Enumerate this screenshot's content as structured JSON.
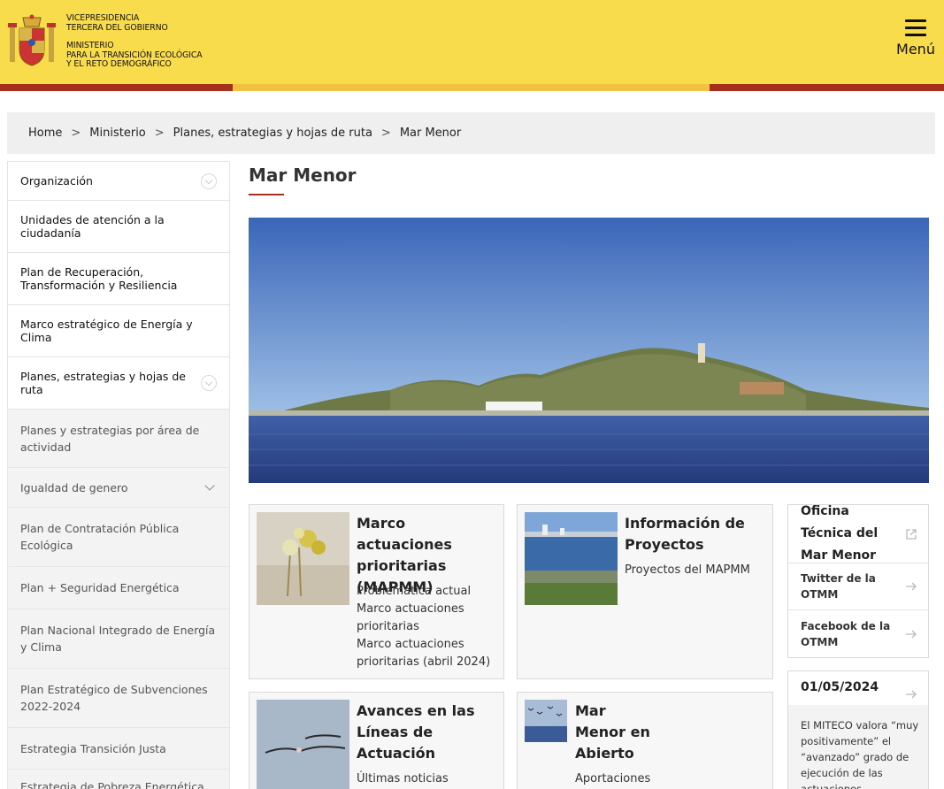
{
  "header": {
    "ministry_line1": "Vicepresidencia",
    "ministry_line2": "Tercera del Gobierno",
    "ministry_line3": "Ministerio",
    "ministry_line4": "para la Transición Ecológica",
    "ministry_line5": "y el Reto Demográfico",
    "menu_label": "Menú",
    "colors": {
      "yellow": "#f8dc4c",
      "red": "#a5301e"
    }
  },
  "breadcrumb": {
    "items": [
      "Home",
      "Ministerio",
      "Planes, estrategias y hojas de ruta",
      "Mar Menor"
    ],
    "separator": ">"
  },
  "sidebar": {
    "items": [
      {
        "label": "Organización"
      },
      {
        "label": "Unidades de atención a la ciudadanía"
      },
      {
        "label": "Plan de Recuperación, Transformación y Resiliencia"
      },
      {
        "label": "Marco estratégico de Energía y Clima"
      },
      {
        "label": "Planes, estrategias y hojas de ruta"
      }
    ],
    "subitems": [
      {
        "label": "Planes y estrategias por área de actividad"
      },
      {
        "label": "Igualdad de genero"
      },
      {
        "label": "Plan de Contratación Pública Ecológica"
      },
      {
        "label": "Plan + Seguridad Energética"
      },
      {
        "label": "Plan Nacional Integrado de Energía y Clima"
      },
      {
        "label": "Plan Estratégico de Subvenciones 2022-2024"
      },
      {
        "label": "Estrategia Transición Justa"
      },
      {
        "label": "Estrategia de Pobreza Energética"
      }
    ]
  },
  "main": {
    "title": "Mar Menor",
    "cards": [
      {
        "title": "Marco actuaciones prioritarias (MAPMM)",
        "links": [
          "Problemática actual",
          "Marco actuaciones prioritarias",
          "Marco actuaciones prioritarias (abril 2024)"
        ]
      },
      {
        "title": "Información de Proyectos",
        "links": [
          "Proyectos del MAPMM"
        ]
      },
      {
        "title": "Avances en las Líneas de Actuación",
        "links": [
          "Últimas noticias"
        ]
      },
      {
        "title": "Mar Menor en Abierto",
        "links": [
          "Aportaciones"
        ]
      }
    ]
  },
  "aside": {
    "office_title": "Oficina Técnica del Mar Menor",
    "links": [
      "Twitter de la OTMM",
      "Facebook de la OTMM"
    ],
    "news": {
      "date": "01/05/2024",
      "text": "El MITECO valora “muy positivamente” el “avanzado” grado de ejecución de las actuaciones"
    }
  }
}
